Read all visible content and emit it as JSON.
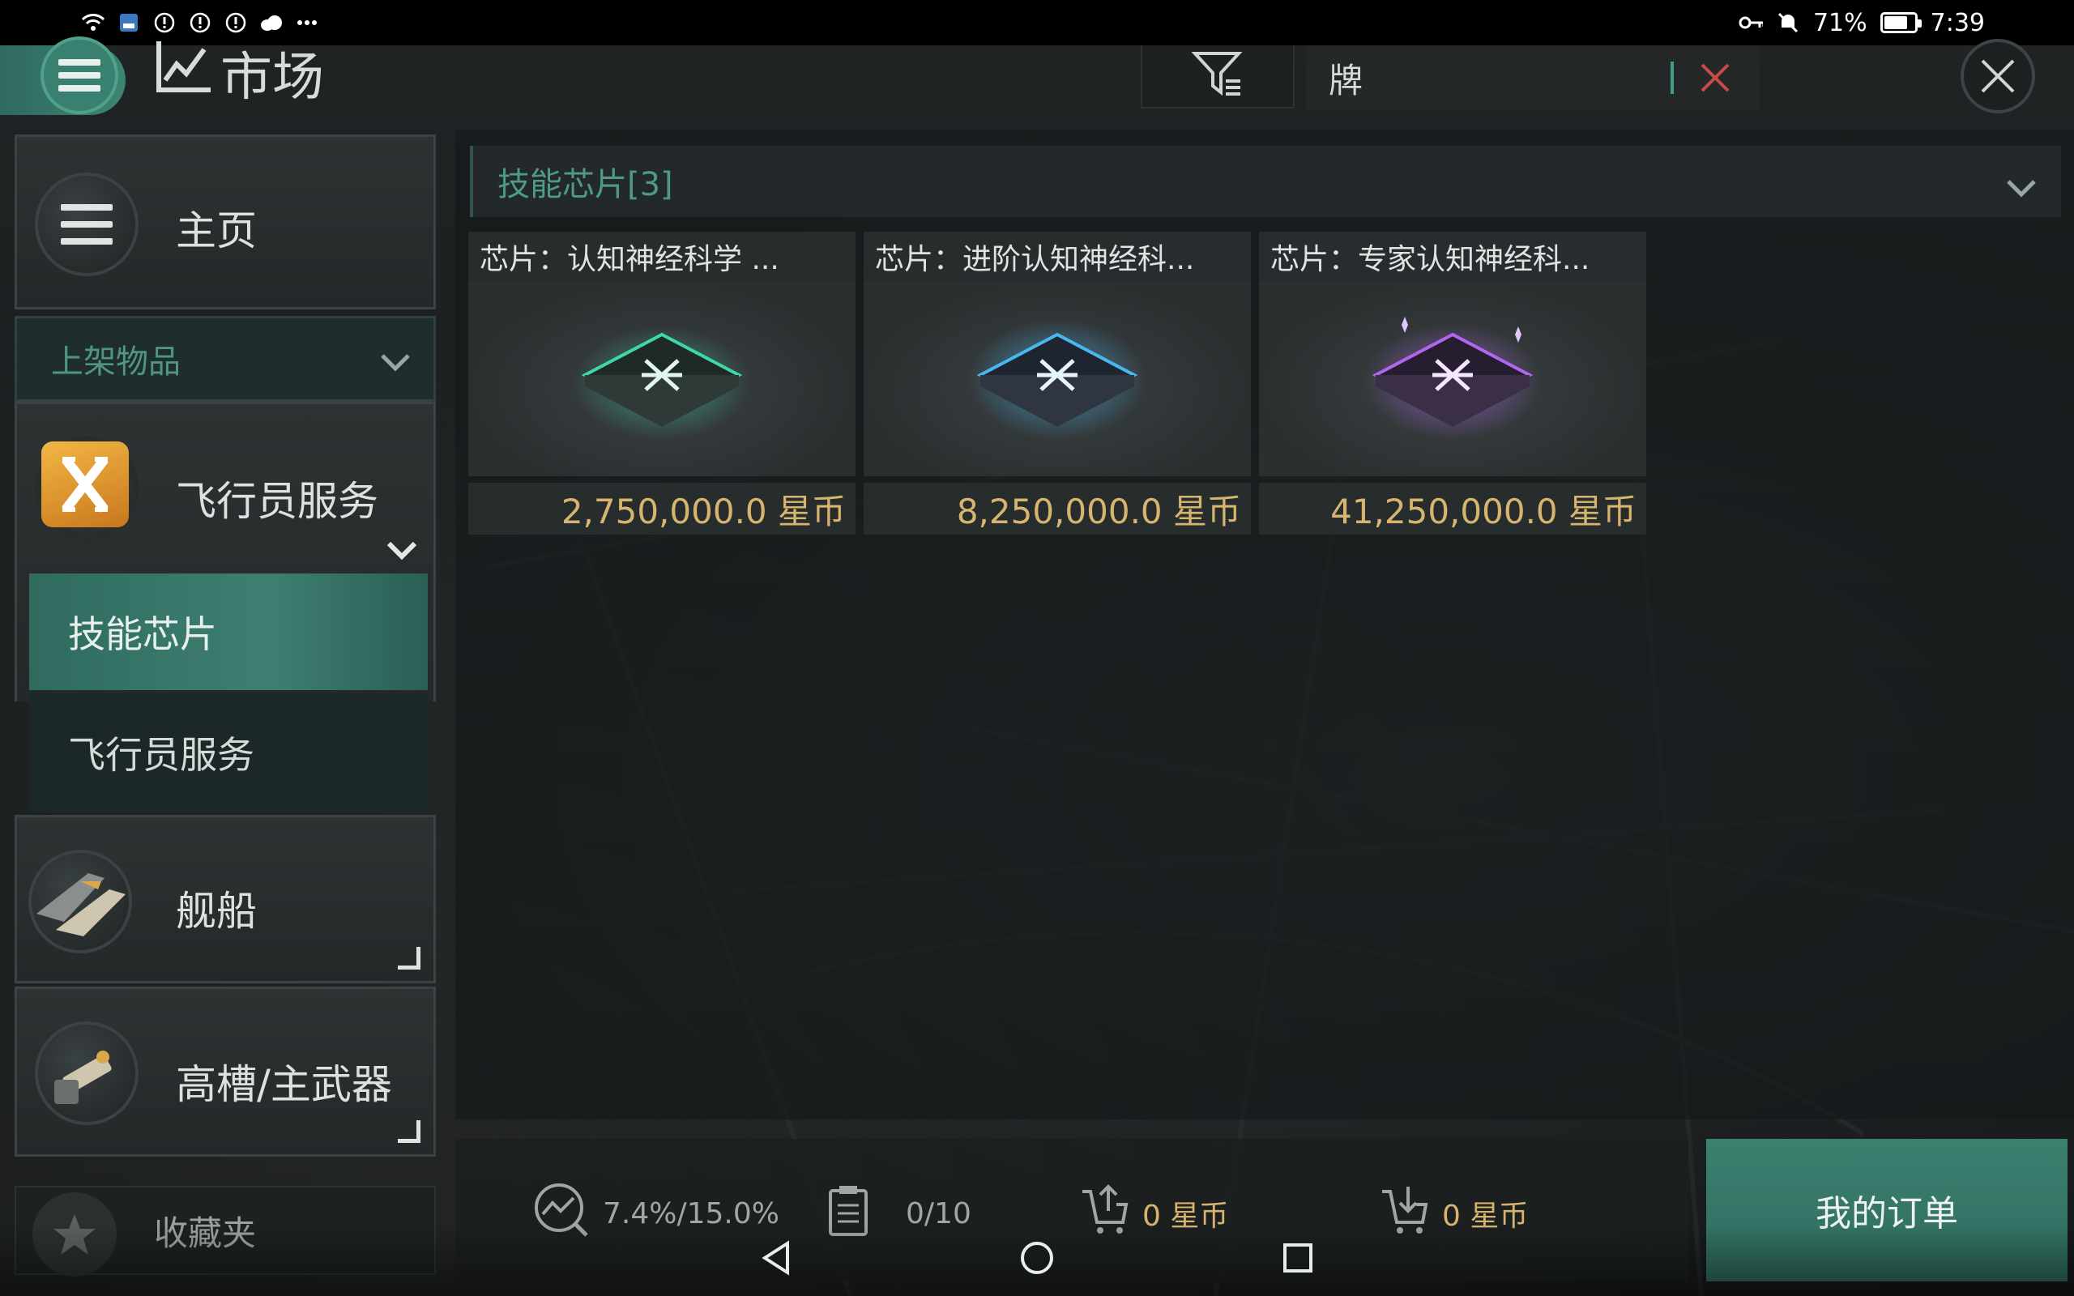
{
  "status_bar": {
    "battery": "71%",
    "time": "7:39"
  },
  "header": {
    "title": "市场",
    "search_value": "牌"
  },
  "sidebar": {
    "home_label": "主页",
    "listed_label": "上架物品",
    "categories": [
      {
        "label": "飞行员服务"
      },
      {
        "label": "技能芯片"
      },
      {
        "label": "飞行员服务"
      },
      {
        "label": "舰船"
      },
      {
        "label": "高槽/主武器"
      }
    ],
    "favorites_label": "收藏夹"
  },
  "main": {
    "section_title": "技能芯片[3]",
    "items": [
      {
        "title": "芯片：认知神经科学 ...",
        "price": "2,750,000.0 星币",
        "glow": "#3fd6a8"
      },
      {
        "title": "芯片：进阶认知神经科...",
        "price": "8,250,000.0 星币",
        "glow": "#4ab6f0"
      },
      {
        "title": "芯片：专家认知神经科...",
        "price": "41,250,000.0 星币",
        "glow": "#b266f0"
      }
    ]
  },
  "bottom": {
    "tax": "7.4%/15.0%",
    "orders_count": "0/10",
    "sell_total": "0 星币",
    "buy_total": "0 星币",
    "my_orders_label": "我的订单"
  },
  "colors": {
    "accent": "#3c8070",
    "gold": "#d6b46d",
    "teal_text": "#4e9a86"
  }
}
